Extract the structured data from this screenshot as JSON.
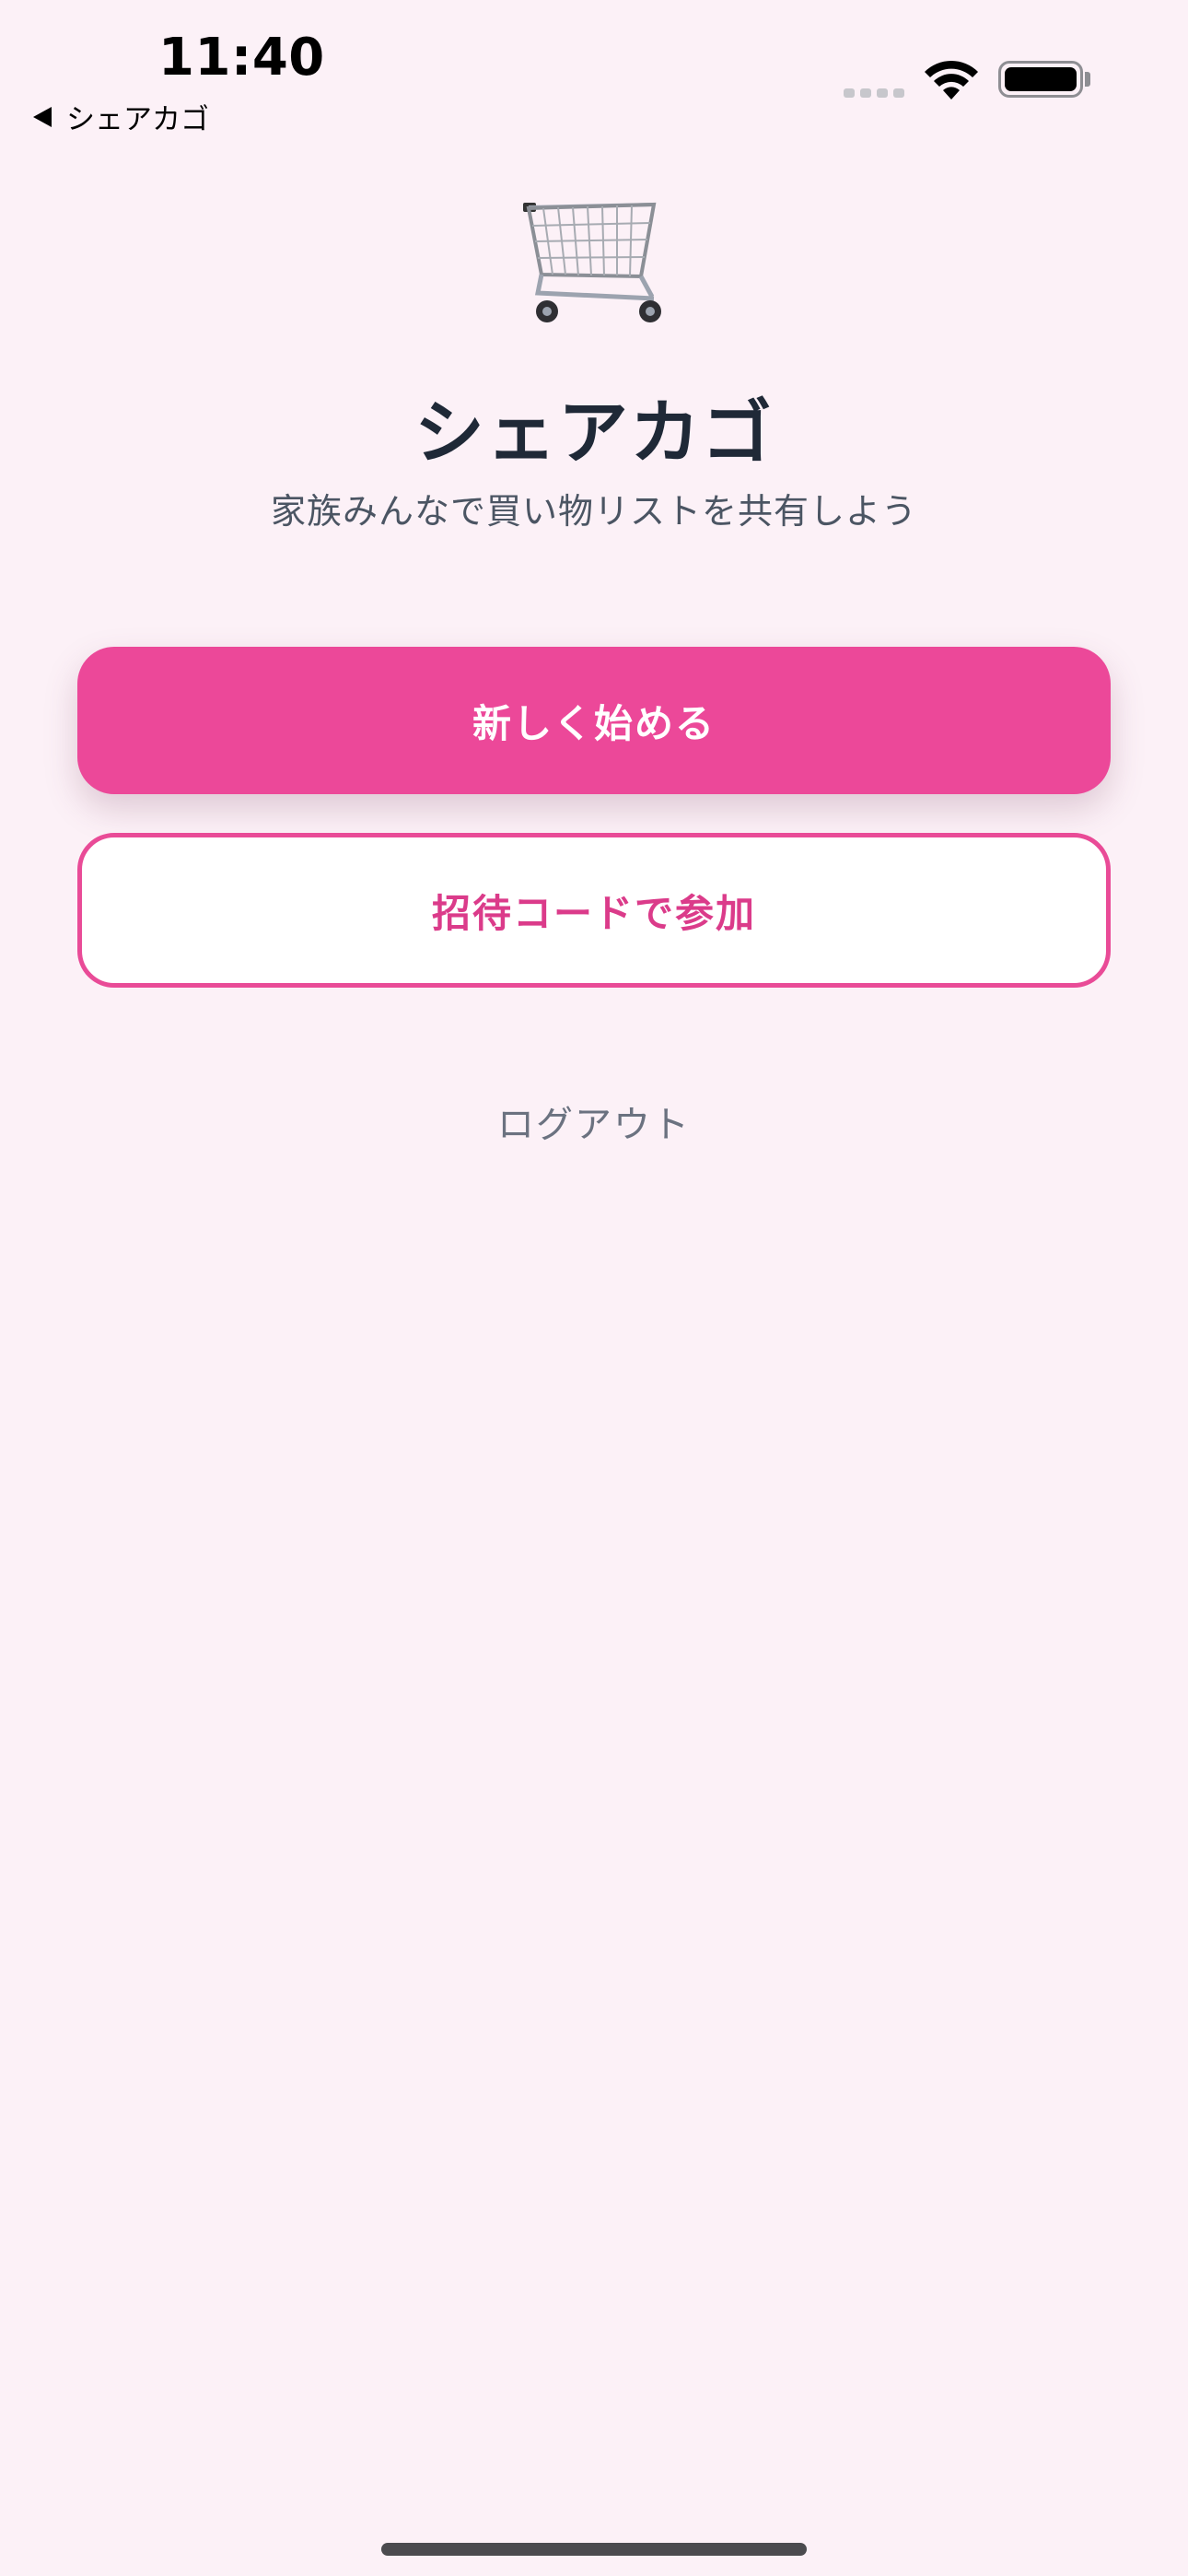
{
  "status_bar": {
    "time": "11:40",
    "back_label": "シェアカゴ"
  },
  "hero": {
    "icon": "shopping-cart-icon",
    "title": "シェアカゴ",
    "subtitle": "家族みんなで買い物リストを共有しよう"
  },
  "actions": {
    "start_label": "新しく始める",
    "join_label": "招待コードで参加",
    "logout_label": "ログアウト"
  },
  "colors": {
    "background": "#fcf1f7",
    "accent": "#ec4899",
    "title_text": "#1f2937",
    "muted_text": "#6b7280"
  }
}
